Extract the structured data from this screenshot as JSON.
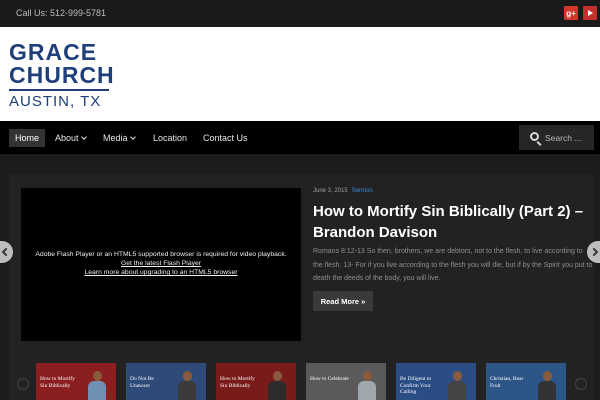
{
  "topbar": {
    "phone": "Call Us: 512-999-5781",
    "gplus_label": "g+"
  },
  "logo": {
    "line1": "GRACE",
    "line2": "CHURCH",
    "line3": "AUSTIN, TX"
  },
  "nav": {
    "items": [
      {
        "label": "Home"
      },
      {
        "label": "About"
      },
      {
        "label": "Media"
      },
      {
        "label": "Location"
      },
      {
        "label": "Contact Us"
      }
    ],
    "search_placeholder": "Search ..."
  },
  "featured": {
    "video_message": "Adobe Flash Player or an HTML5 supported browser is required for video playback.",
    "video_link1": "Get the latest Flash Player",
    "video_link2": "Learn more about upgrading to an HTML5 browser",
    "date": "June 3, 2015",
    "category": "Sermon",
    "title": "How to Mortify Sin Biblically (Part 2) – Brandon Davison",
    "excerpt": "Romans 8:12-13 So then, brothers, we are debtors, not to the flesh, to live according to the flesh. 13- For if you live according to the flesh you will die, but if by the Spirit you put to death the deeds of the body, you will live.",
    "read_more": "Read More »"
  },
  "thumbnails": [
    {
      "caption": "How to Mortify Sin Biblically",
      "bg": "#8b1f1f",
      "shirt": "#6f8fb5"
    },
    {
      "caption": "Do Not Be Unaware",
      "bg": "#2d4a78",
      "shirt": "#3a3a3a"
    },
    {
      "caption": "How to Mortify Sin Biblically",
      "bg": "#7a1b1b",
      "shirt": "#2c2c2c"
    },
    {
      "caption": "How to Celebrate",
      "bg": "#5a5a5a",
      "shirt": "#a0a6ad"
    },
    {
      "caption": "Be Diligent to Confirm Your Calling",
      "bg": "#2a4d86",
      "shirt": "#444444"
    },
    {
      "caption": "Christian, Bear Fruit",
      "bg": "#2c5687",
      "shirt": "#333333"
    }
  ]
}
